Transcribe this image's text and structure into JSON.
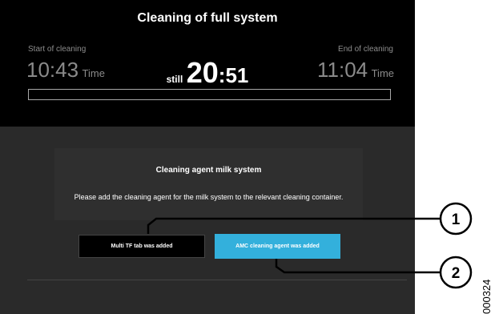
{
  "header": {
    "title": "Cleaning of full system",
    "start_label": "Start of cleaning",
    "start_time": "10:43",
    "start_unit": "Time",
    "end_label": "End of cleaning",
    "end_time": "11:04",
    "end_unit": "Time",
    "remaining_prefix": "still",
    "remaining_minutes": "20",
    "remaining_seconds": ":51",
    "progress_fraction": 0
  },
  "panel": {
    "title": "Cleaning agent milk system",
    "message": "Please add the cleaning agent for the milk system to the relevant cleaning container."
  },
  "buttons": {
    "multi_tf": "Multi TF tab was added",
    "amc": "AMC cleaning agent was added"
  },
  "callouts": [
    "1",
    "2"
  ],
  "document_id": "000324",
  "colors": {
    "header_bg": "#000000",
    "screen_bg": "#2a2a2a",
    "accent": "#33b0dc"
  }
}
